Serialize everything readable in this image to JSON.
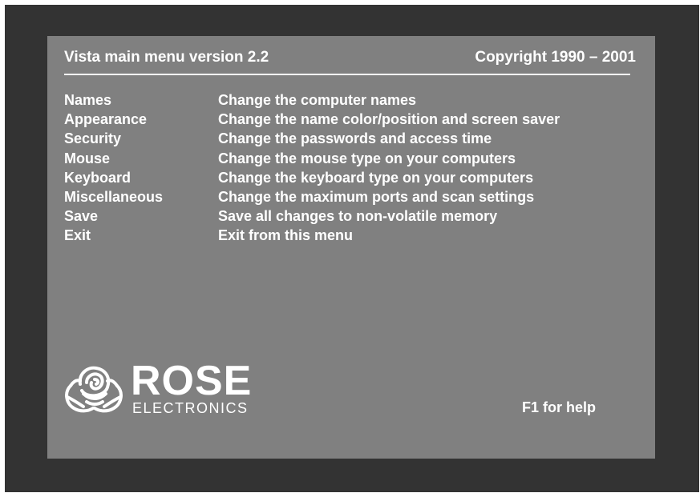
{
  "window": {
    "title": "Vista main menu version 2.2",
    "copyright": "Copyright 1990 – 2001"
  },
  "menu": {
    "items": [
      {
        "key": "Names",
        "description": "Change the computer names"
      },
      {
        "key": "Appearance",
        "description": "Change the name color/position and screen saver"
      },
      {
        "key": "Security",
        "description": "Change the passwords and access time"
      },
      {
        "key": "Mouse",
        "description": "Change the mouse type on your computers"
      },
      {
        "key": "Keyboard",
        "description": "Change the keyboard type on your computers"
      },
      {
        "key": "Miscellaneous",
        "description": "Change the maximum ports and scan settings"
      },
      {
        "key": "Save",
        "description": "Save all changes to non-volatile memory"
      },
      {
        "key": "Exit",
        "description": "Exit from this menu"
      }
    ]
  },
  "logo": {
    "word": "ROSE",
    "subtitle": "ELECTRONICS",
    "icon": "rose-icon"
  },
  "footer": {
    "help": "F1 for help"
  },
  "colors": {
    "frame": "#333333",
    "screen": "#808080",
    "text": "#ffffff"
  }
}
